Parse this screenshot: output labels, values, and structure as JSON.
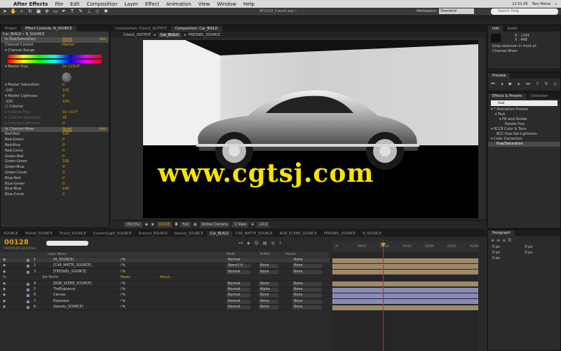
{
  "menubar": {
    "app_name": "After Effects",
    "items": [
      "File",
      "Edit",
      "Composition",
      "Layer",
      "Effect",
      "Animation",
      "View",
      "Window",
      "Help"
    ],
    "user": "Tam Home",
    "clock": "12:51:43"
  },
  "toolbar": {
    "project_title": "AFX224_Class4.aep *",
    "workspace_label": "Workspace:",
    "workspace_value": "Standard",
    "search_placeholder": "Search Help"
  },
  "effect_panel": {
    "tabs": [
      "Project",
      "Effect Controls: N_SOURCE"
    ],
    "breadcrumb": "Car_BUILD • N_SOURCE",
    "rows": [
      {
        "label": "fx  Hue/Saturation",
        "link": "Reset",
        "about": "Abo",
        "kind": "head"
      },
      {
        "label": "Channel Control",
        "value": "Master",
        "kind": "row"
      },
      {
        "label": "▾ Channel Range",
        "kind": "row"
      },
      {
        "label": "▾ Master Hue",
        "value": "0x +23.0°",
        "kind": "row"
      },
      {
        "label": "▾ Master Saturation",
        "value": "0",
        "kind": "row"
      },
      {
        "label": "-100",
        "value": "100",
        "kind": "row"
      },
      {
        "label": "▾ Master Lightness",
        "value": "0",
        "kind": "row"
      },
      {
        "label": "-100",
        "value": "100",
        "kind": "row"
      },
      {
        "label": "☐ Colorize",
        "kind": "row"
      },
      {
        "label": "▸ Colorize Hue",
        "value": "0x +0.0°",
        "kind": "dim"
      },
      {
        "label": "▸ Colorize Saturation",
        "value": "25",
        "kind": "dim"
      },
      {
        "label": "▸ Colorize Lightness",
        "value": "0",
        "kind": "dim"
      },
      {
        "label": "fx  Channel Mixer",
        "link": "Reset",
        "about": "Abo",
        "kind": "head"
      },
      {
        "label": "Red-Red",
        "value": "100",
        "kind": "row"
      },
      {
        "label": "Red-Green",
        "value": "0",
        "kind": "row"
      },
      {
        "label": "Red-Blue",
        "value": "0",
        "kind": "row"
      },
      {
        "label": "Red-Const",
        "value": "0",
        "kind": "row"
      },
      {
        "label": "Green-Red",
        "value": "0",
        "kind": "row"
      },
      {
        "label": "Green-Green",
        "value": "100",
        "kind": "row"
      },
      {
        "label": "Green-Blue",
        "value": "0",
        "kind": "row"
      },
      {
        "label": "Green-Const",
        "value": "0",
        "kind": "row"
      },
      {
        "label": "Blue-Red",
        "value": "0",
        "kind": "row"
      },
      {
        "label": "Blue-Green",
        "value": "0",
        "kind": "row"
      },
      {
        "label": "Blue-Blue",
        "value": "100",
        "kind": "row"
      },
      {
        "label": "Blue-Const",
        "value": "0",
        "kind": "row"
      }
    ]
  },
  "comp_panel": {
    "tab_top_left": "Composition: Class1_OUTPUT",
    "tab_top_right": "Composition: Car_BUILD",
    "flowchart": [
      "Class1_OUTPUT",
      "Car_BUILD",
      "FRESNEL_SOURCE"
    ],
    "watermark": "www.cgtsj.com",
    "footer": {
      "zoom": "(59.5%)",
      "timecode": "00128",
      "resolution": "Full",
      "camera": "Active Camera",
      "view": "1 View",
      "exposure": "+0.0"
    }
  },
  "info_panel": {
    "tabs": [
      "Info",
      "Audio"
    ],
    "r": "R : 1191",
    "x": "X : 448",
    "message_1": "Drop selection in front of:",
    "message_2": "Channel Mixer"
  },
  "preview_panel": {
    "title": "Preview"
  },
  "effects_panel": {
    "tabs": [
      "Effects & Presets",
      "Character"
    ],
    "search_value": "hue",
    "items": [
      {
        "label": "▾ * Animation Presets",
        "sel": false
      },
      {
        "label": "▾ Text",
        "sel": false
      },
      {
        "label": "▾ Fill and Stroke",
        "sel": false
      },
      {
        "label": "Rotate Hue",
        "sel": false
      },
      {
        "label": "▾ 8CC8 Color & Tone",
        "sel": false
      },
      {
        "label": "BCC Hue-Sat-Lightness",
        "sel": false
      },
      {
        "label": "▾ Color Correction",
        "sel": false
      },
      {
        "label": "Hue/Saturation",
        "sel": true
      }
    ]
  },
  "paragraph_panel": {
    "title": "Paragraph",
    "fields": [
      "0 px",
      "0 px",
      "0 px",
      "0 px",
      "0 px"
    ]
  },
  "timeline": {
    "tabs": [
      "SOURCE",
      "Trishdi_SOURCE",
      "Trishd_SOURCE",
      "CustomLight_SOURCE",
      "Ground_SOURCE",
      "beauty_SOURCE",
      "Car_BUILD",
      "CAR_MATTE_SOURCE",
      "RGB_SCENE_SOURCE",
      "FRESNEL_SOURCE",
      "N_SOURCE"
    ],
    "active_tab": "Car_BUILD",
    "timecode": "00128",
    "subtime": "0:00:05:08 (24.00 fps)",
    "columns": {
      "name": "Layer Name",
      "mode": "Mode",
      "trkmat": "TrkMat",
      "parent": "Parent"
    },
    "ruler_labels": [
      "0f",
      "00050",
      "00100",
      "00150",
      "00200",
      "00250",
      "00300"
    ],
    "layers": [
      {
        "num": "1",
        "name": "[N_SOURCE]",
        "mode": "Normal",
        "trk": "",
        "parent": "None",
        "kind": "sel",
        "color": "#9e8a6a"
      },
      {
        "num": "2",
        "name": "[CAR_MATTE_SOURCE]",
        "mode": "Stencil A",
        "trk": "None",
        "parent": "None",
        "kind": "row",
        "color": "#9e8a6a"
      },
      {
        "num": "3",
        "name": "[FRESNEL_SOURCE]",
        "mode": "Normal",
        "trk": "None",
        "parent": "None",
        "kind": "row",
        "color": "#9e8a6a"
      },
      {
        "num": "",
        "name": "Set Matte",
        "mode": "Reset",
        "trk": "About...",
        "parent": "",
        "kind": "sub",
        "color": ""
      },
      {
        "num": "4",
        "name": "[RGB_SCENE_SOURCE]",
        "mode": "Normal",
        "trk": "None",
        "parent": "None",
        "kind": "row",
        "color": "#9e8a6a"
      },
      {
        "num": "5",
        "name": "TireExposure",
        "mode": "Normal",
        "trk": "Alpha",
        "parent": "None",
        "kind": "row",
        "color": "#8a8ab8"
      },
      {
        "num": "6",
        "name": "Canvas",
        "mode": "Normal",
        "trk": "None",
        "parent": "None",
        "kind": "row",
        "color": "#8a8ab8"
      },
      {
        "num": "7",
        "name": "Exposure",
        "mode": "Normal",
        "trk": "None",
        "parent": "None",
        "kind": "row",
        "color": "#8a8ab8"
      },
      {
        "num": "8",
        "name": "[beauty_SOURCE]",
        "mode": "Normal",
        "trk": "None",
        "parent": "None",
        "kind": "row",
        "color": "#9e8a6a"
      }
    ]
  }
}
